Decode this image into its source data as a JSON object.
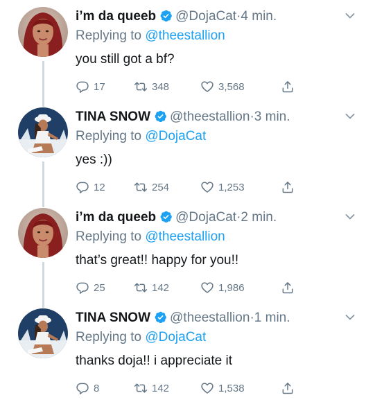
{
  "tweets": [
    {
      "name": "i’m da queeb",
      "handle": "@DojaCat",
      "separator": "·",
      "time": "4 min.",
      "replying_prefix": "Replying to",
      "replying_to": "@theestallion",
      "text": "you still got a bf?",
      "replies": "17",
      "retweets": "348",
      "likes": "3,568",
      "avatar": "doja-avatar"
    },
    {
      "name": "TINA SNOW",
      "handle": "@theestallion",
      "separator": "·",
      "time": "3 min.",
      "replying_prefix": "Replying to",
      "replying_to": "@DojaCat",
      "text": "yes :))",
      "replies": "12",
      "retweets": "254",
      "likes": "1,253",
      "avatar": "megan-avatar"
    },
    {
      "name": "i’m da queeb",
      "handle": "@DojaCat",
      "separator": "·",
      "time": "2 min.",
      "replying_prefix": "Replying to",
      "replying_to": "@theestallion",
      "text": "that’s great!! happy for you!!",
      "replies": "25",
      "retweets": "142",
      "likes": "1,986",
      "avatar": "doja-avatar"
    },
    {
      "name": "TINA SNOW",
      "handle": "@theestallion",
      "separator": "·",
      "time": "1 min.",
      "replying_prefix": "Replying to",
      "replying_to": "@DojaCat",
      "text": "thanks doja!! i appreciate it",
      "replies": "8",
      "retweets": "142",
      "likes": "1,538",
      "avatar": "megan-avatar"
    }
  ],
  "colors": {
    "accent": "#1da1f2",
    "secondary_text": "#657786",
    "primary_text": "#14171a",
    "thread_line": "#cfd9de"
  },
  "icons": [
    "verified-badge-icon",
    "chevron-down-icon",
    "reply-icon",
    "retweet-icon",
    "like-icon",
    "share-icon"
  ]
}
